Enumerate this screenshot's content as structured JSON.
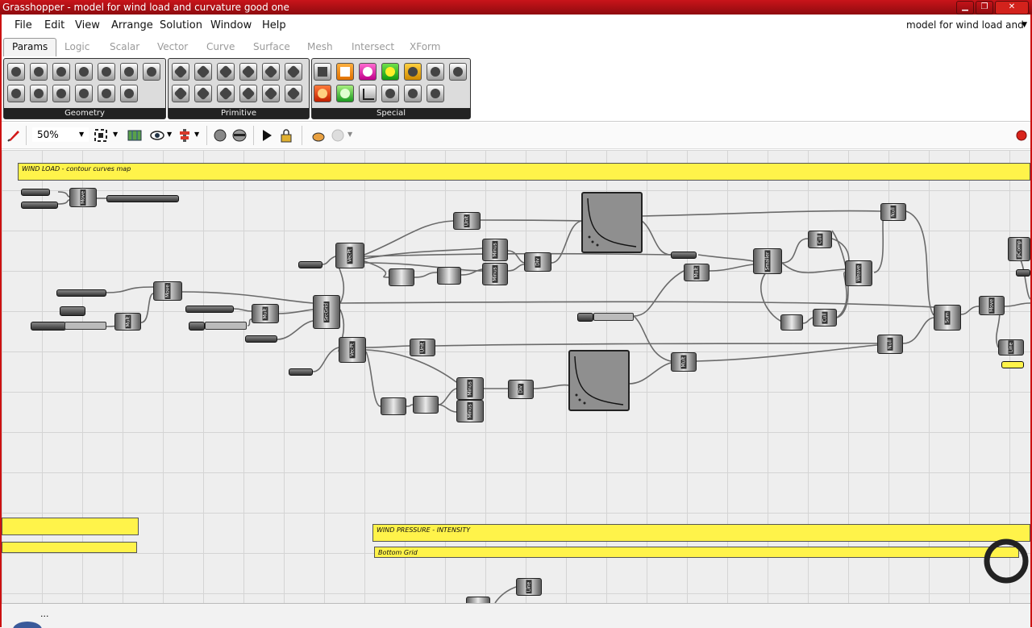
{
  "window": {
    "title": "Grasshopper - model for wind load and curvature good one"
  },
  "menu": [
    "File",
    "Edit",
    "View",
    "Arrange",
    "Solution",
    "Window",
    "Help"
  ],
  "document_selector": "model for wind load and",
  "tabs": [
    "Params",
    "Logic",
    "Scalar",
    "Vector",
    "Curve",
    "Surface",
    "Mesh",
    "Intersect",
    "XForm"
  ],
  "ribbon": {
    "groups": [
      "Geometry",
      "Primitive",
      "Special"
    ]
  },
  "toolbar": {
    "zoom": "50%"
  },
  "canvas": {
    "groups": [
      {
        "label": "WIND LOAD  -  contour curves map"
      },
      {
        "label": "WIND PRESSURE  -  INTENSITY"
      },
      {
        "label": "Bottom Grid"
      }
    ],
    "components": [
      "Move",
      "VecPt",
      "Unit",
      "Minus",
      "Div",
      "Mult",
      "SrcGrid",
      "Null",
      "Smaller",
      "Cull",
      "Weave",
      "Sum",
      "Line",
      "Srf",
      "pComp"
    ]
  },
  "status": {
    "text": "..."
  },
  "colors": {
    "titlebar": "#b5121b",
    "group_fill": "#fff34a",
    "canvas": "#eeeeee"
  }
}
